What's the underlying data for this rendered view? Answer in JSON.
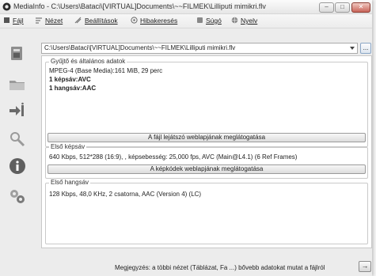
{
  "window": {
    "title": "MediaInfo - C:\\Users\\Bataci\\[VIRTUAL]Documents\\~~FILMEK\\Lilliputi mimikri.flv",
    "buttons": {
      "minimize": "–",
      "maximize": "□",
      "close": "✕"
    }
  },
  "menu": [
    {
      "label": "Fájl",
      "icon": "file-icon"
    },
    {
      "label": "Nézet",
      "icon": "view-icon"
    },
    {
      "label": "Beállítások",
      "icon": "settings-icon"
    },
    {
      "label": "Hibakeresés",
      "icon": "debug-icon"
    },
    {
      "label": "Súgó",
      "icon": "help-icon"
    },
    {
      "label": "Nyelv",
      "icon": "language-icon"
    }
  ],
  "sidebar": [
    "open-file-icon",
    "open-folder-icon",
    "export-icon",
    "search-icon",
    "info-icon",
    "settings-gears-icon"
  ],
  "path": {
    "value": "C:\\Users\\Bataci\\[VIRTUAL]Documents\\~~FILMEK\\Lilliputi mimikri.flv",
    "more_label": "..."
  },
  "general": {
    "title": "Gyűjtő és általános adatok",
    "format": "MPEG-4 (Base Media):161 MiB, 29 perc",
    "video_count": "1 képsáv:AVC",
    "audio_count": "1 hangsáv:AAC",
    "player_button": "A fájl lejátszó weblapjának meglátogatása"
  },
  "video": {
    "title": "Első képsáv",
    "details": "640 Kbps, 512*288 (16:9), , képsebesség: 25,000 fps, AVC (Main@L4.1) (6 Ref Frames)",
    "codec_button": "A képkódek weblapjának meglátogatása"
  },
  "audio": {
    "title": "Első hangsáv",
    "details": "128 Kbps, 48,0 KHz, 2 csatorna, AAC (Version 4) (LC)"
  },
  "footer": {
    "note": "Megjegyzés: a többi nézet (Táblázat, Fa ...) bővebb adatokat mutat a fájlról",
    "next_label": "→"
  }
}
